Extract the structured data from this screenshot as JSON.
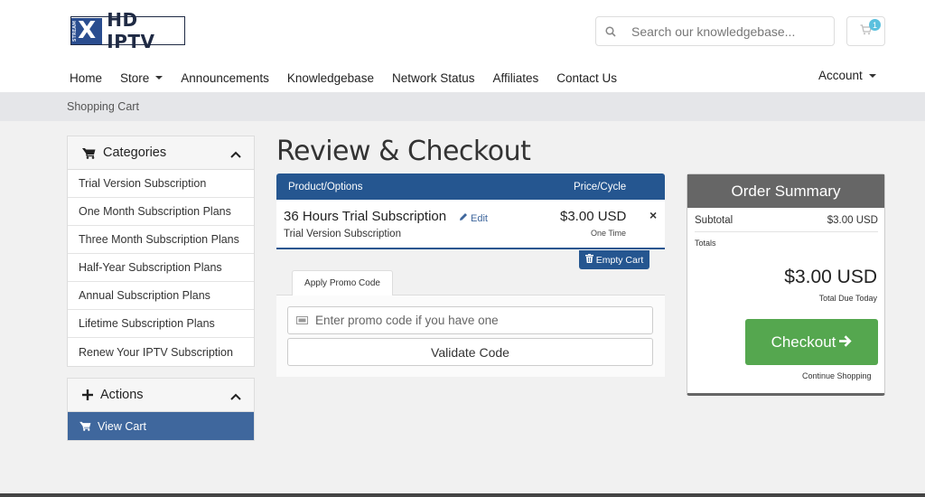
{
  "brand": {
    "logo_mark": "X",
    "logo_sub": "STREAM",
    "logo_text": "HD IPTV"
  },
  "search": {
    "placeholder": "Search our knowledgebase..."
  },
  "cart": {
    "count": "1"
  },
  "nav": {
    "home": "Home",
    "store": "Store",
    "announcements": "Announcements",
    "knowledgebase": "Knowledgebase",
    "network_status": "Network Status",
    "affiliates": "Affiliates",
    "contact_us": "Contact Us",
    "account": "Account"
  },
  "breadcrumb": "Shopping Cart",
  "categories": {
    "title": "Categories",
    "items": [
      "Trial Version Subscription",
      "One Month Subscription Plans",
      "Three Month Subscription Plans",
      "Half-Year Subscription Plans",
      "Annual Subscription Plans",
      "Lifetime Subscription Plans",
      "Renew Your IPTV Subscription"
    ]
  },
  "actions": {
    "title": "Actions",
    "view_cart": "View Cart"
  },
  "page_title": "Review & Checkout",
  "cart_table": {
    "col_product": "Product/Options",
    "col_price": "Price/Cycle",
    "item": {
      "name": "36 Hours Trial Subscription",
      "edit": "Edit",
      "group": "Trial Version Subscription",
      "price": "$3.00 USD",
      "cycle": "One Time",
      "remove": "×"
    },
    "empty_cart": "Empty Cart"
  },
  "promo": {
    "tab": "Apply Promo Code",
    "placeholder": "Enter promo code if you have one",
    "validate": "Validate Code"
  },
  "summary": {
    "title": "Order Summary",
    "subtotal_label": "Subtotal",
    "subtotal_value": "$3.00 USD",
    "totals_label": "Totals",
    "total": "$3.00 USD",
    "total_due": "Total Due Today",
    "checkout": "Checkout",
    "continue": "Continue Shopping"
  },
  "colors": {
    "primary": "#255690",
    "sidebar_active": "#3f679d",
    "checkout_green": "#55a74f",
    "summary_header": "#666666",
    "badge": "#5bc0de"
  },
  "icons": [
    "search-icon",
    "cart-icon",
    "chevron-up-icon",
    "plus-icon",
    "pencil-icon",
    "trash-icon",
    "ticket-icon",
    "arrow-right-icon"
  ]
}
